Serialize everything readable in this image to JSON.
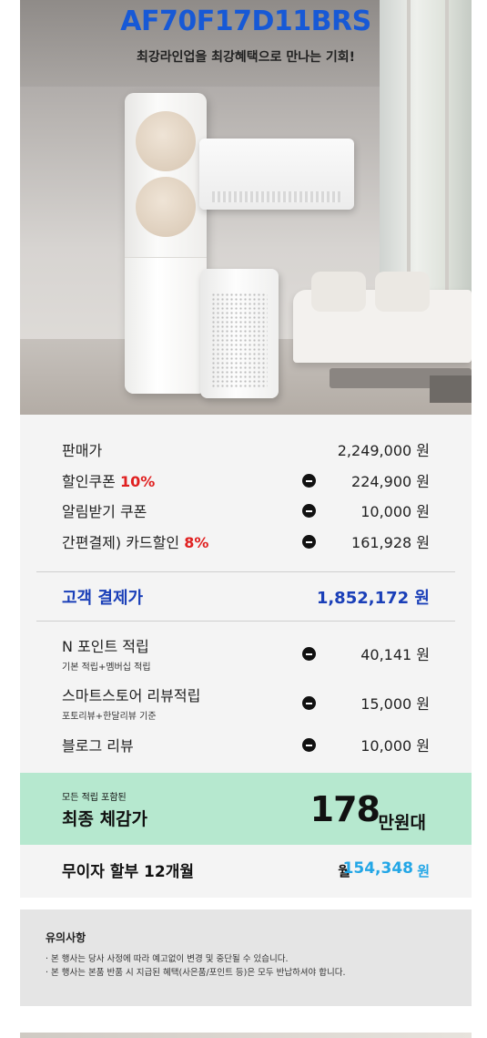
{
  "hero": {
    "model": "AF70F17D11BRS",
    "subtitle": "최강라인업을 최강혜택으로 만나는 기회!"
  },
  "price": {
    "rows": [
      {
        "label": "판매가",
        "value": "2,249,000 원"
      },
      {
        "label": "할인쿠폰 ",
        "highlight": "10%",
        "value": "224,900 원",
        "minus": true
      },
      {
        "label": "알림받기 쿠폰",
        "value": "10,000 원",
        "minus": true
      },
      {
        "label": "간편결제) 카드할인 ",
        "highlight": "8%",
        "value": "161,928 원",
        "minus": true
      }
    ],
    "payment": {
      "label": "고객 결제가",
      "value": "1,852,172 원"
    },
    "points": [
      {
        "label": "N 포인트 적립",
        "sub": "기본 적립+멤버십 적립",
        "value": "40,141 원",
        "minus": true
      },
      {
        "label": "스마트스토어 리뷰적립",
        "sub": "포토리뷰+한달리뷰 기준",
        "value": "15,000 원",
        "minus": true
      },
      {
        "label": "블로그 리뷰",
        "value": "10,000 원",
        "minus": true
      }
    ]
  },
  "final": {
    "small": "모든 적립 포함된",
    "label": "최종 체감가",
    "number": "178",
    "unit": "만원대"
  },
  "installment": {
    "label": "무이자 할부 12개월",
    "prefix": "월",
    "amount": "154,348",
    "won": "원"
  },
  "notice": {
    "title": "유의사항",
    "lines": [
      "· 본 행사는 당사 사정에 따라 예고없이 변경 및 중단될 수 있습니다.",
      "· 본 행사는 본품 반품 시 지급된 혜택(사은품/포인트 등)은 모두 반납하셔야 합니다."
    ]
  },
  "colors": {
    "model": "#1759d6",
    "payment": "#1a3fb8",
    "discount_pct": "#e02020",
    "final_bg": "#b6e8cf",
    "installment_amount": "#22a6e6"
  }
}
